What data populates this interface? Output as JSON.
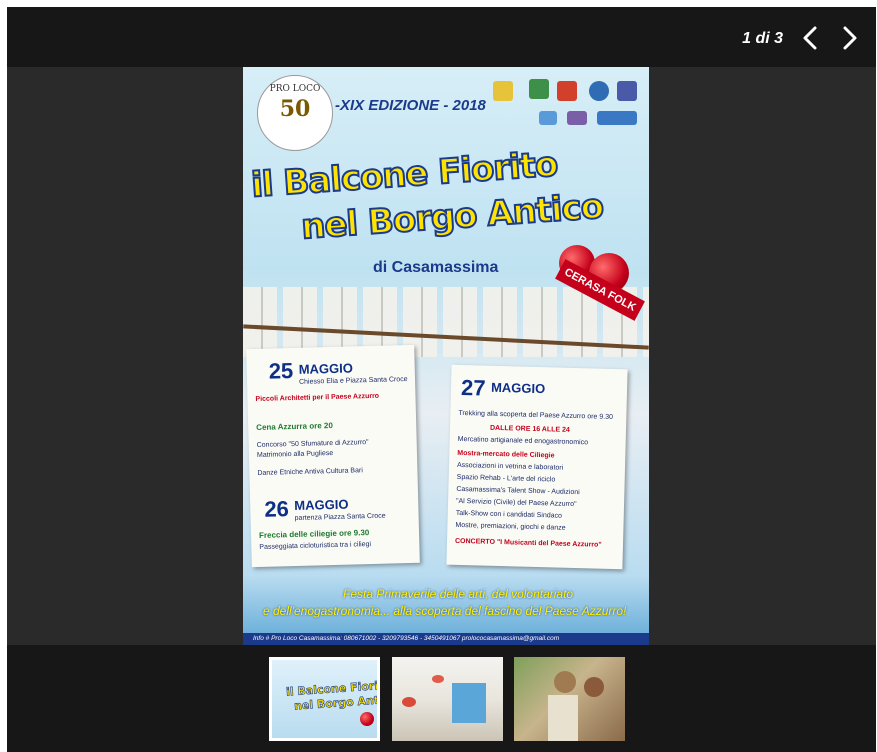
{
  "viewer": {
    "counter": "1 di 3",
    "prev_icon": "chevron-left-icon",
    "next_icon": "chevron-right-icon"
  },
  "poster": {
    "badge_text": "PRO LOCO",
    "badge_number": "50",
    "edition": "-XIX EDIZIONE - 2018",
    "title_line1": "il Balcone Fiorito",
    "title_line2": "nel Borgo Antico",
    "subtitle": "di Casamassima",
    "ribbon": "CERASA FOLK",
    "day1": {
      "day": "25",
      "month": "MAGGIO",
      "place": "Chiesso Elia e Piazza Santa Croce",
      "lines": [
        "Piccoli Architetti per il Paese Azzurro",
        "Cena Azzurra ore 20",
        "Concorso \"50 Sfumature di Azzurro\"",
        "Matrimonio alla Pugliese",
        "Danze Etniche Antiva Cultura Bari"
      ]
    },
    "day2": {
      "day": "26",
      "month": "MAGGIO",
      "place": "partenza Piazza Santa Croce",
      "lines": [
        "Freccia delle ciliegie ore 9.30",
        "Passeggiata cicloturistica tra i ciliegi"
      ]
    },
    "day3": {
      "day": "27",
      "month": "MAGGIO",
      "lines": [
        "Trekking alla scoperta del Paese Azzurro ore 9.30",
        "DALLE ORE 16 ALLE 24",
        "Mercatino artigianale ed enogastronomico",
        "Mostra-mercato delle Ciliegie",
        "Associazioni in vetrina e laboratori",
        "Spazio Rehab - L'arte del riciclo",
        "Casamassima's Talent Show - Audizioni",
        "\"Al Servizio (Civile) del Paese Azzurro\"",
        "Talk-Show con i candidati Sindaco",
        "Mostre, premiazioni, giochi e danze",
        "CONCERTO \"I Musicanti del Paese Azzurro\""
      ]
    },
    "footer_line1": "Festa Primaverile delle arti, del volontariato",
    "footer_line2": "e dell'enogastronomia... alla scoperta del fascino del Paese Azzurro!",
    "info": "Info  # Pro Loco Casamassima: 080671002 - 3209793546 - 3450491067  prolococasamassima@gmail.com"
  },
  "thumbnails": [
    {
      "state": "active"
    },
    {
      "state": "inactive"
    },
    {
      "state": "inactive"
    }
  ]
}
